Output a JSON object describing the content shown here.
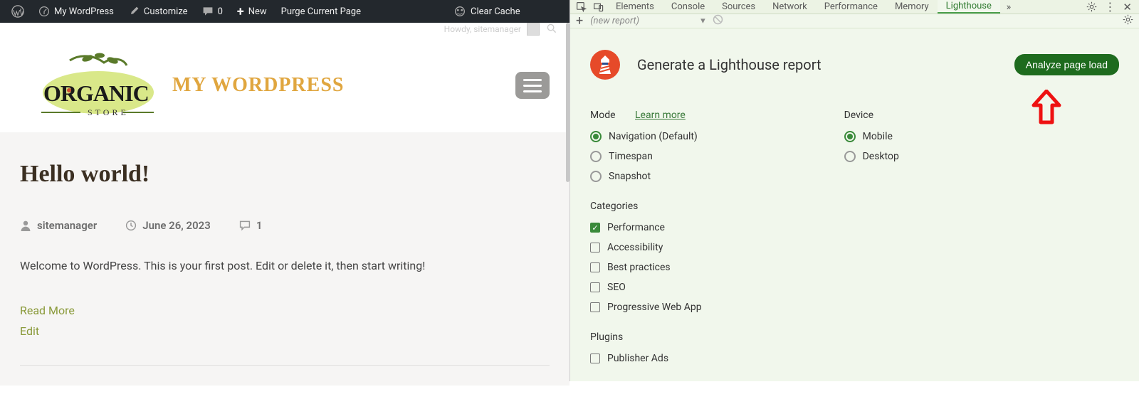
{
  "wp": {
    "adminbar": {
      "site_name": "My WordPress",
      "customize": "Customize",
      "comments_count": "0",
      "new_label": "New",
      "purge_page": "Purge Current Page",
      "clear_cache": "Clear Cache"
    },
    "howdy": "Howdy, sitemanager",
    "site_title": "MY WORDPRESS",
    "post": {
      "title": "Hello world!",
      "author": "sitemanager",
      "date": "June 26, 2023",
      "comment_count": "1",
      "body": "Welcome to WordPress. This is your first post. Edit or delete it, then start writing!",
      "read_more": "Read More",
      "edit": "Edit"
    }
  },
  "devtools": {
    "tabs": {
      "elements": "Elements",
      "console": "Console",
      "sources": "Sources",
      "network": "Network",
      "performance": "Performance",
      "memory": "Memory",
      "lighthouse": "Lighthouse"
    },
    "toolbar": {
      "new_report": "(new report)"
    },
    "lighthouse": {
      "title": "Generate a Lighthouse report",
      "analyze_btn": "Analyze page load",
      "mode_label": "Mode",
      "learn_more": "Learn more",
      "modes": {
        "navigation": "Navigation (Default)",
        "timespan": "Timespan",
        "snapshot": "Snapshot"
      },
      "device_label": "Device",
      "devices": {
        "mobile": "Mobile",
        "desktop": "Desktop"
      },
      "categories_label": "Categories",
      "categories": {
        "performance": "Performance",
        "accessibility": "Accessibility",
        "best_practices": "Best practices",
        "seo": "SEO",
        "pwa": "Progressive Web App"
      },
      "plugins_label": "Plugins",
      "plugins": {
        "publisher_ads": "Publisher Ads"
      }
    }
  }
}
